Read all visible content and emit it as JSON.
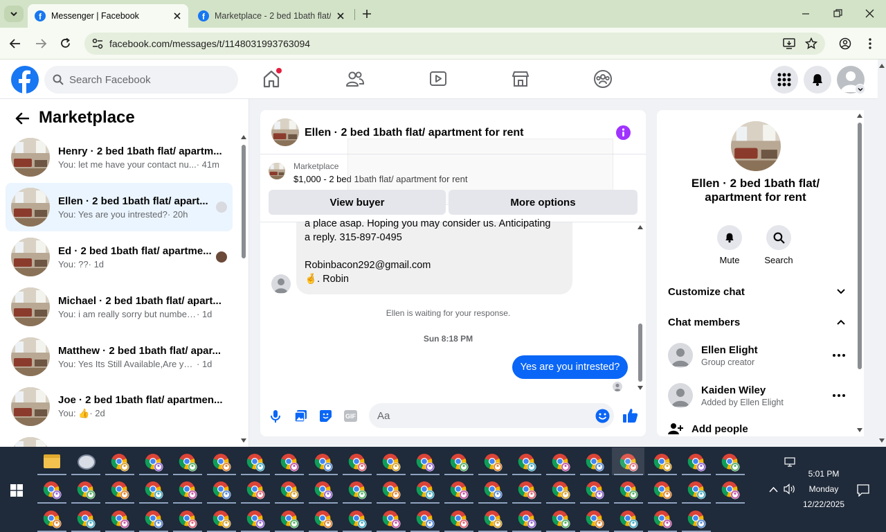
{
  "browser": {
    "tabs": [
      {
        "title": "Messenger | Facebook",
        "active": true
      },
      {
        "title": "Marketplace - 2 bed 1bath flat/",
        "active": false
      }
    ],
    "url": "facebook.com/messages/t/1148031993763094"
  },
  "fb": {
    "search_placeholder": "Search Facebook"
  },
  "sidebar": {
    "title": "Marketplace",
    "conversations": [
      {
        "name": "Henry · 2 bed 1bath flat/ apartm...",
        "snippet": "You: let me have your contact nu...",
        "time": "· 41m"
      },
      {
        "name": "Ellen · 2 bed 1bath flat/ apart...",
        "snippet": "You: Yes are you intrested?",
        "time": "· 20h"
      },
      {
        "name": "Ed · 2 bed 1bath flat/ apartme...",
        "snippet": "You: ??",
        "time": "· 1d"
      },
      {
        "name": "Michael · 2 bed 1bath flat/ apart...",
        "snippet": "You: i am really sorry but number a...",
        "time": "· 1d"
      },
      {
        "name": "Matthew · 2 bed 1bath flat/ apar...",
        "snippet": "You: Yes Its Still Available,Are you in...",
        "time": "· 1d"
      },
      {
        "name": "Joe · 2 bed 1bath flat/ apartmen...",
        "snippet": "You: 👍",
        "time": "· 2d"
      },
      {
        "name": "Jody · 2 bed 1bath flat/ apartme...",
        "snippet": "",
        "time": ""
      }
    ]
  },
  "chat": {
    "header_title": "Ellen · 2 bed 1bath flat/ apartment for rent",
    "listing_source": "Marketplace",
    "listing_title": "$1,000 - 2 bed 1bath flat/ apartment for rent",
    "view_buyer": "View buyer",
    "more_options": "More options",
    "incoming_lines": [
      "a place asap.  Hoping you may consider us. Anticipating",
      "a reply. 315-897-0495",
      "",
      "Robinbacon292@gmail.com",
      "🤞. Robin"
    ],
    "waiting_note": "Ellen is waiting for your response.",
    "timestamp": "Sun 8:18 PM",
    "outgoing": "Yes are you intrested?",
    "composer_placeholder": "Aa"
  },
  "details": {
    "title": "Ellen · 2 bed 1bath flat/ apartment for rent",
    "mute": "Mute",
    "search": "Search",
    "customize": "Customize chat",
    "members_header": "Chat members",
    "members": [
      {
        "name": "Ellen Elight",
        "role": "Group creator"
      },
      {
        "name": "Kaiden Wiley",
        "role": "Added by Ellen Elight"
      }
    ],
    "add_people": "Add people"
  },
  "taskbar": {
    "time": "5:01 PM",
    "day": "Monday",
    "date": "12/22/2025"
  },
  "colors": {
    "fb_blue": "#1877f2",
    "messenger_blue": "#0a66f6",
    "info_purple": "#a033ff"
  }
}
